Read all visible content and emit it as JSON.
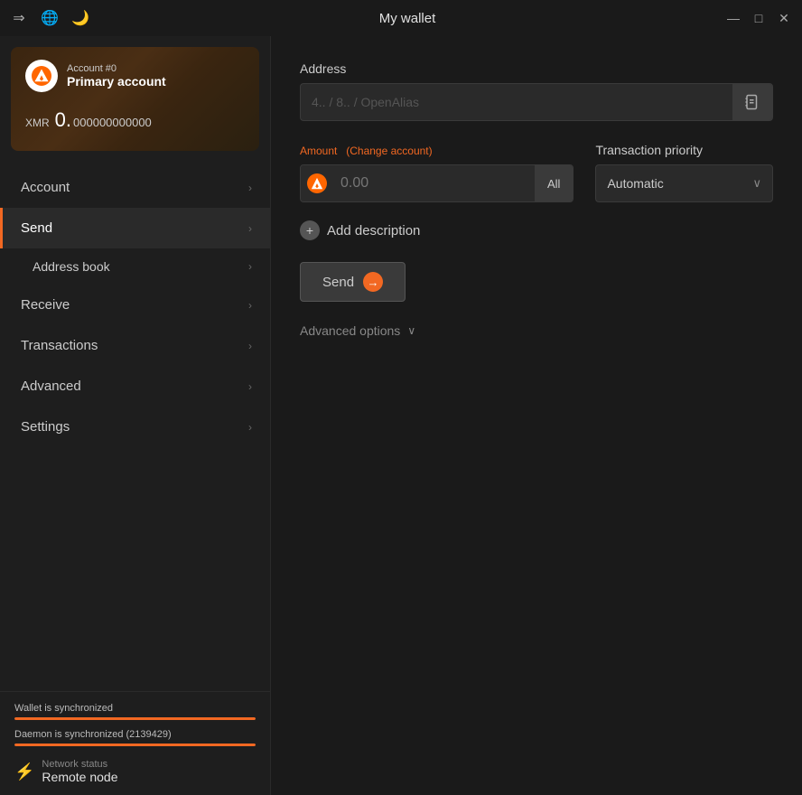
{
  "titlebar": {
    "title": "My wallet",
    "icons": {
      "transfer": "⇒",
      "globe": "🌐",
      "moon": "🌙"
    },
    "controls": {
      "minimize": "—",
      "maximize": "□",
      "close": "✕"
    }
  },
  "account": {
    "number": "Account #0",
    "name": "Primary account",
    "currency": "XMR",
    "balance_main": "0.",
    "balance_decimal": "000000000000"
  },
  "nav": {
    "items": [
      {
        "label": "Account",
        "active": false,
        "sub": false
      },
      {
        "label": "Send",
        "active": true,
        "sub": false
      },
      {
        "label": "Address book",
        "active": false,
        "sub": true
      },
      {
        "label": "Receive",
        "active": false,
        "sub": false
      },
      {
        "label": "Transactions",
        "active": false,
        "sub": false
      },
      {
        "label": "Advanced",
        "active": false,
        "sub": false
      },
      {
        "label": "Settings",
        "active": false,
        "sub": false
      }
    ]
  },
  "status": {
    "wallet_sync_label": "Wallet is synchronized",
    "wallet_sync_pct": 100,
    "daemon_sync_label": "Daemon is synchronized (2139429)",
    "daemon_sync_pct": 100,
    "network_label": "Network status",
    "network_value": "Remote node"
  },
  "send_form": {
    "address_label": "Address",
    "address_placeholder": "4.. / 8.. / OpenAlias",
    "amount_label": "Amount",
    "amount_change": "(Change account)",
    "amount_placeholder": "0.00",
    "all_button": "All",
    "priority_label": "Transaction priority",
    "priority_value": "Automatic",
    "add_description": "Add description",
    "send_button": "Send",
    "advanced_options": "Advanced options"
  }
}
